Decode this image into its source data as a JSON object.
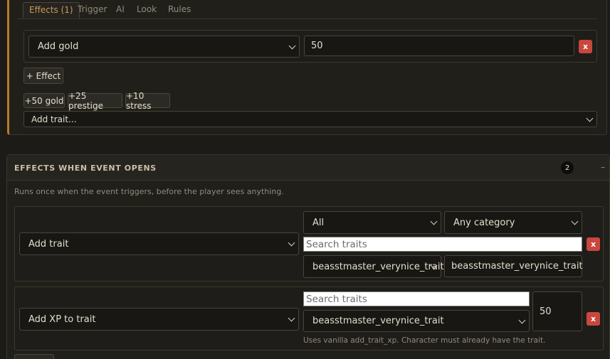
{
  "top": {
    "tabs": [
      "Effects (1)",
      "Trigger",
      "AI",
      "Look",
      "Rules"
    ],
    "effect": {
      "type": "Add gold",
      "value": "50",
      "remove_label": "x"
    },
    "add_effect_label": "+ Effect",
    "chips": [
      "+50 gold",
      "+25 prestige",
      "+10 stress"
    ],
    "add_trait_select": "Add trait..."
  },
  "section": {
    "title": "EFFECTS WHEN EVENT OPENS",
    "count": "2",
    "collapse": "–",
    "description": "Runs once when the event triggers, before the player sees anything.",
    "rows": [
      {
        "type": "Add trait",
        "filter_scope": "All",
        "filter_category": "Any category",
        "search_placeholder": "Search traits",
        "trait_select": "beasstmaster_verynice_trait",
        "trait_value": "beasstmaster_verynice_trait",
        "remove_label": "x"
      },
      {
        "type": "Add XP to trait",
        "search_placeholder": "Search traits",
        "trait_select": "beasstmaster_verynice_trait",
        "xp_value": "50",
        "hint": "Uses vanilla add_trait_xp. Character must already have the trait.",
        "remove_label": "x"
      }
    ]
  }
}
